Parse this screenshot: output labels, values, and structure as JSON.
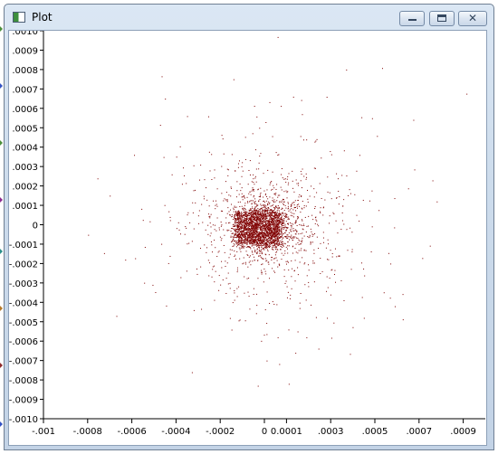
{
  "window": {
    "title": "Plot",
    "icon": "plot-window-icon",
    "buttons": {
      "minimize": "minimize-icon",
      "maximize": "maximize-icon",
      "close": "close-icon"
    }
  },
  "chart_data": {
    "type": "scatter",
    "title": "",
    "xlabel": "",
    "ylabel": "",
    "xlim": [
      -0.001,
      0.001
    ],
    "ylim": [
      -0.001,
      0.001
    ],
    "x_tick_labels": [
      ".0009",
      ".0007",
      ".0005",
      ".0003",
      "0.0001",
      "0",
      "-.0002",
      "-.0004",
      "-.0006",
      "-.0008",
      "-.001"
    ],
    "y_tick_labels": [
      ".0010",
      ".0009",
      ".0008",
      ".0007",
      ".0006",
      ".0005",
      ".0004",
      ".0003",
      ".0002",
      ".0001",
      "0",
      "-.0001",
      "-.0002",
      "-.0003",
      "-.0004",
      "-.0005",
      "-.0006",
      "-.0007",
      "-.0008",
      "-.0009",
      "-.0010"
    ],
    "grid": false,
    "legend": "none",
    "point_color": "#7f0000",
    "point_count_estimate": 3400,
    "distribution": {
      "center": [
        0.0,
        0.0
      ],
      "core_std": 5e-05,
      "inner_std": 8e-05,
      "outer_std": 0.0002,
      "halo_std": 0.00034,
      "dense_rectangle": {
        "x": [
          -0.00013,
          7e-05
        ],
        "y": [
          -0.0001,
          7e-05
        ]
      }
    },
    "scattered_points": [
      [
        0.00037,
        0.0008
      ],
      [
        -0.00014,
        0.00075
      ],
      [
        -0.00045,
        0.00065
      ],
      [
        0.00013,
        0.00066
      ],
      [
        -0.00035,
        0.00056
      ],
      [
        0.00017,
        0.00057
      ],
      [
        -0.00059,
        0.00036
      ],
      [
        0.00043,
        0.00036
      ],
      [
        -0.0007,
        0.00015
      ],
      [
        0.00078,
        0.00012
      ],
      [
        -0.00063,
        -0.00018
      ],
      [
        0.00057,
        -0.0002
      ],
      [
        -0.00067,
        -0.00047
      ],
      [
        -0.00032,
        -0.00044
      ],
      [
        0.00059,
        -0.00042
      ],
      [
        0.00045,
        -0.00048
      ],
      [
        0.00015,
        -0.00055
      ],
      [
        0.00019,
        -0.00058
      ],
      [
        6e-05,
        -0.00058
      ],
      [
        0.00014,
        -0.00066
      ],
      [
        1e-05,
        -0.0007
      ],
      [
        -3e-05,
        -0.00083
      ],
      [
        0.00011,
        -0.00082
      ]
    ]
  },
  "left_edge_markers": [
    {
      "color": "#4b8f3b"
    },
    {
      "color": "#3352c4"
    },
    {
      "color": "#4b8f3b"
    },
    {
      "color": "#8b2a8f"
    },
    {
      "color": "#2b8f8a"
    },
    {
      "color": "#b57a2b"
    },
    {
      "color": "#8f2b2b"
    },
    {
      "color": "#3352c4"
    }
  ]
}
